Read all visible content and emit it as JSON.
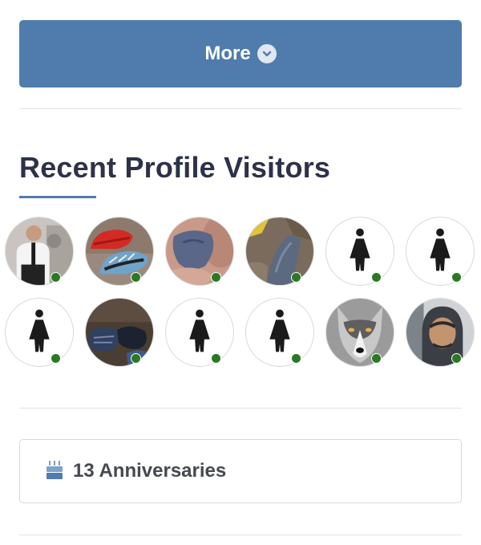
{
  "more_button": {
    "label": "More",
    "icon": "chevron-down-circle-icon"
  },
  "recent_visitors": {
    "title": "Recent Profile Visitors",
    "accent_color": "#4f7cac",
    "online_color": "#2b7a23",
    "visitors": [
      {
        "avatar": "photo-man-in-white-shirt",
        "online": true
      },
      {
        "avatar": "photo-red-and-blue-sneakers",
        "online": true
      },
      {
        "avatar": "photo-blue-underwear",
        "online": true
      },
      {
        "avatar": "photo-jeans-on-couch",
        "online": true
      },
      {
        "avatar": "default-female-silhouette",
        "online": true
      },
      {
        "avatar": "default-female-silhouette",
        "online": true
      },
      {
        "avatar": "default-female-silhouette",
        "online": true
      },
      {
        "avatar": "photo-dark-socks",
        "online": true
      },
      {
        "avatar": "default-female-silhouette",
        "online": true
      },
      {
        "avatar": "default-female-silhouette",
        "online": true
      },
      {
        "avatar": "photo-wolf",
        "online": true
      },
      {
        "avatar": "photo-man-in-hoodie-car",
        "online": true
      }
    ]
  },
  "anniversaries": {
    "label": "13 Anniversaries",
    "icon": "birthday-cake-icon"
  }
}
